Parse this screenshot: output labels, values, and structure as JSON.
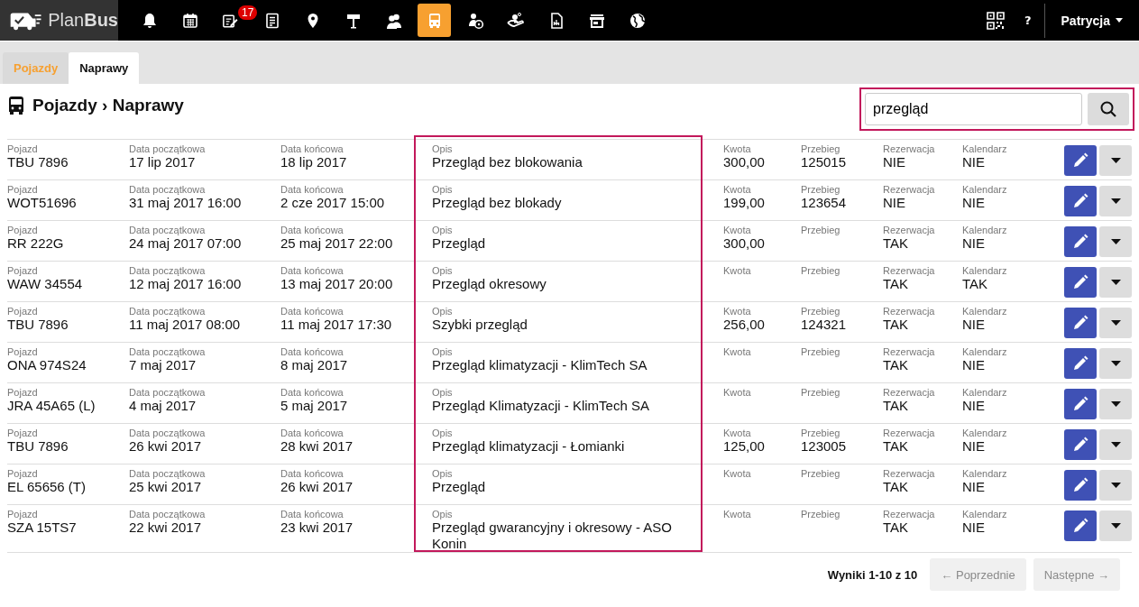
{
  "topbar": {
    "logo": {
      "plan": "Plan",
      "bus": "Bus"
    },
    "nav": [
      {
        "kind": "bell",
        "selected": false
      },
      {
        "kind": "calendar",
        "selected": false
      },
      {
        "kind": "edit",
        "selected": false,
        "badge": "17"
      },
      {
        "kind": "document",
        "selected": false
      },
      {
        "kind": "pin",
        "selected": false
      },
      {
        "kind": "sign",
        "selected": false
      },
      {
        "kind": "people",
        "selected": false
      },
      {
        "kind": "bus",
        "selected": true
      },
      {
        "kind": "driver",
        "selected": false
      },
      {
        "kind": "payment",
        "selected": false
      },
      {
        "kind": "report",
        "selected": false
      },
      {
        "kind": "store",
        "selected": false
      },
      {
        "kind": "globe",
        "selected": false
      }
    ],
    "help": "?",
    "user": "Patrycja"
  },
  "tabs": [
    {
      "label": "Pojazdy",
      "selected": false
    },
    {
      "label": "Naprawy",
      "selected": true
    }
  ],
  "heading": "Pojazdy › Naprawy",
  "search": {
    "value": "przegląd",
    "highlighted": true
  },
  "description_column_highlighted": true,
  "rows": [
    {
      "cells": [
        {
          "label": "Pojazd",
          "value": "TBU 7896"
        },
        {
          "label": "Data początkowa",
          "value": "17 lip 2017"
        },
        {
          "label": "Data końcowa",
          "value": "18 lip 2017"
        },
        {
          "label": "Opis",
          "value": "Przegląd bez blokowania"
        },
        {
          "label": "Kwota",
          "value": "300,00"
        },
        {
          "label": "Przebieg",
          "value": "125015"
        },
        {
          "label": "Rezerwacja",
          "value": "NIE"
        },
        {
          "label": "Kalendarz",
          "value": "NIE"
        }
      ]
    },
    {
      "cells": [
        {
          "label": "Pojazd",
          "value": "WOT51696"
        },
        {
          "label": "Data początkowa",
          "value": "31 maj 2017 16:00"
        },
        {
          "label": "Data końcowa",
          "value": "2 cze 2017 15:00"
        },
        {
          "label": "Opis",
          "value": "Przegląd bez blokady"
        },
        {
          "label": "Kwota",
          "value": "199,00"
        },
        {
          "label": "Przebieg",
          "value": "123654"
        },
        {
          "label": "Rezerwacja",
          "value": "NIE"
        },
        {
          "label": "Kalendarz",
          "value": "NIE"
        }
      ]
    },
    {
      "cells": [
        {
          "label": "Pojazd",
          "value": "RR 222G"
        },
        {
          "label": "Data początkowa",
          "value": "24 maj 2017 07:00"
        },
        {
          "label": "Data końcowa",
          "value": "25 maj 2017 22:00"
        },
        {
          "label": "Opis",
          "value": "Przegląd"
        },
        {
          "label": "Kwota",
          "value": "300,00"
        },
        {
          "label": "Przebieg"
        },
        {
          "label": "Rezerwacja",
          "value": "TAK"
        },
        {
          "label": "Kalendarz",
          "value": "NIE"
        }
      ]
    },
    {
      "cells": [
        {
          "label": "Pojazd",
          "value": "WAW 34554"
        },
        {
          "label": "Data początkowa",
          "value": "12 maj 2017 16:00"
        },
        {
          "label": "Data końcowa",
          "value": "13 maj 2017 20:00"
        },
        {
          "label": "Opis",
          "value": "Przegląd okresowy"
        },
        {
          "label": "Kwota"
        },
        {
          "label": "Przebieg"
        },
        {
          "label": "Rezerwacja",
          "value": "TAK"
        },
        {
          "label": "Kalendarz",
          "value": "TAK"
        }
      ]
    },
    {
      "cells": [
        {
          "label": "Pojazd",
          "value": "TBU 7896"
        },
        {
          "label": "Data początkowa",
          "value": "11 maj 2017 08:00"
        },
        {
          "label": "Data końcowa",
          "value": "11 maj 2017 17:30"
        },
        {
          "label": "Opis",
          "value": "Szybki przegląd"
        },
        {
          "label": "Kwota",
          "value": "256,00"
        },
        {
          "label": "Przebieg",
          "value": "124321"
        },
        {
          "label": "Rezerwacja",
          "value": "TAK"
        },
        {
          "label": "Kalendarz",
          "value": "NIE"
        }
      ]
    },
    {
      "cells": [
        {
          "label": "Pojazd",
          "value": "ONA 974S24"
        },
        {
          "label": "Data początkowa",
          "value": "7 maj 2017"
        },
        {
          "label": "Data końcowa",
          "value": "8 maj 2017"
        },
        {
          "label": "Opis",
          "value": "Przegląd klimatyzacji - KlimTech SA"
        },
        {
          "label": "Kwota"
        },
        {
          "label": "Przebieg"
        },
        {
          "label": "Rezerwacja",
          "value": "TAK"
        },
        {
          "label": "Kalendarz",
          "value": "NIE"
        }
      ]
    },
    {
      "cells": [
        {
          "label": "Pojazd",
          "value": "JRA 45A65 (L)"
        },
        {
          "label": "Data początkowa",
          "value": "4 maj 2017"
        },
        {
          "label": "Data końcowa",
          "value": "5 maj 2017"
        },
        {
          "label": "Opis",
          "value": "Przegląd Klimatyzacji - KlimTech SA"
        },
        {
          "label": "Kwota"
        },
        {
          "label": "Przebieg"
        },
        {
          "label": "Rezerwacja",
          "value": "TAK"
        },
        {
          "label": "Kalendarz",
          "value": "NIE"
        }
      ]
    },
    {
      "cells": [
        {
          "label": "Pojazd",
          "value": "TBU 7896"
        },
        {
          "label": "Data początkowa",
          "value": "26 kwi 2017"
        },
        {
          "label": "Data końcowa",
          "value": "28 kwi 2017"
        },
        {
          "label": "Opis",
          "value": "Przegląd klimatyzacji - Łomianki"
        },
        {
          "label": "Kwota",
          "value": "125,00"
        },
        {
          "label": "Przebieg",
          "value": "123005"
        },
        {
          "label": "Rezerwacja",
          "value": "TAK"
        },
        {
          "label": "Kalendarz",
          "value": "NIE"
        }
      ]
    },
    {
      "cells": [
        {
          "label": "Pojazd",
          "value": "EL 65656 (T)"
        },
        {
          "label": "Data początkowa",
          "value": "25 kwi 2017"
        },
        {
          "label": "Data końcowa",
          "value": "26 kwi 2017"
        },
        {
          "label": "Opis",
          "value": "Przegląd"
        },
        {
          "label": "Kwota"
        },
        {
          "label": "Przebieg"
        },
        {
          "label": "Rezerwacja",
          "value": "TAK"
        },
        {
          "label": "Kalendarz",
          "value": "NIE"
        }
      ]
    },
    {
      "cells": [
        {
          "label": "Pojazd",
          "value": "SZA 15TS7"
        },
        {
          "label": "Data początkowa",
          "value": "22 kwi 2017"
        },
        {
          "label": "Data końcowa",
          "value": "23 kwi 2017"
        },
        {
          "label": "Opis",
          "value": "Przegląd gwarancyjny i okresowy - ASO Konin"
        },
        {
          "label": "Kwota"
        },
        {
          "label": "Przebieg"
        },
        {
          "label": "Rezerwacja",
          "value": "TAK"
        },
        {
          "label": "Kalendarz",
          "value": "NIE"
        }
      ]
    }
  ],
  "pagination": {
    "summary": "Wyniki 1-10 z 10",
    "prev": {
      "label": "← Poprzednie",
      "disabled": true
    },
    "next": {
      "label": "Następne →",
      "disabled": true
    }
  }
}
